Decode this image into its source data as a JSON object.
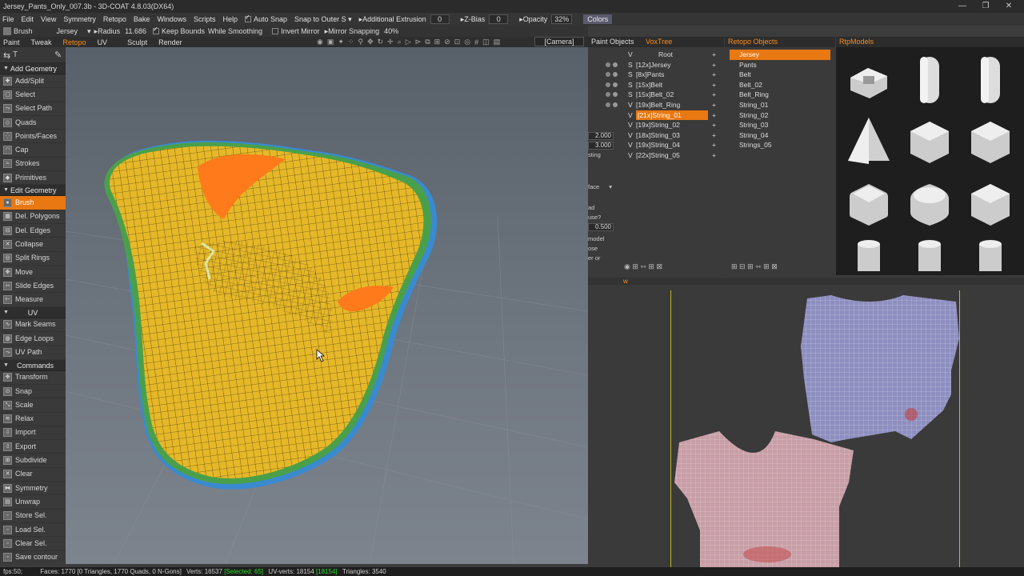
{
  "window": {
    "title": "Jersey_Pants_Only_007.3b - 3D-COAT 4.8.03(DX64)",
    "controls": [
      "—",
      "❐",
      "✕"
    ]
  },
  "menu": [
    "File",
    "Edit",
    "View",
    "Symmetry",
    "Retopo",
    "Bake",
    "Windows",
    "Scripts",
    "Help"
  ],
  "topopts": {
    "auto_snap": "Auto Snap",
    "snap_to_outer": "Snap to Outer S",
    "additional_extrusion": "Additional Extrusion",
    "extrusion_value": "0",
    "zbias_label": "Z-Bias",
    "zbias_value": "0",
    "opacity_label": "Opacity",
    "opacity_value": "32%",
    "colors": "Colors"
  },
  "toolopts": {
    "tool": "Brush",
    "object": "Jersey",
    "radius_label": "Radius",
    "radius_value": "11.686",
    "keep_bounds": "Keep Bounds",
    "while_smoothing": "While Smoothing",
    "invert_mirror": "Invert Mirror",
    "mirror_snapping": "Mirror Snapping",
    "mirror_snapping_value": "40%"
  },
  "rooms": [
    "Paint",
    "Tweak",
    "Retopo",
    "UV",
    "Sculpt",
    "Render"
  ],
  "camera": "[Camera]",
  "toolpanel": {
    "add_geometry": "Add Geometry",
    "add_tools": [
      "Add/Split",
      "Select",
      "Select Path",
      "Quads",
      "Points/Faces",
      "Cap",
      "Strokes",
      "Primitives"
    ],
    "edit_geometry": "Edit Geometry",
    "edit_tools": [
      "Brush",
      "Del. Polygons",
      "Del. Edges",
      "Collapse",
      "Split Rings",
      "Move",
      "Slide Edges",
      "Measure"
    ],
    "uv": "UV",
    "uv_tools": [
      "Mark Seams",
      "Edge Loops",
      "UV Path"
    ],
    "commands": "Commands",
    "command_tools": [
      "Transform",
      "Snap",
      "Scale",
      "Relax",
      "Import",
      "Export",
      "Subdivide",
      "Clear",
      "Symmetry",
      "Unwrap",
      "Store Sel.",
      "Load Sel.",
      "Clear Sel.",
      "Save contour"
    ]
  },
  "paint_objects": {
    "tab1": "Paint Objects",
    "tab2": "VoxTree",
    "items": [
      {
        "s": "",
        "v": "V",
        "name": "Root"
      },
      {
        "s": "S",
        "v": "",
        "name": "[12x]Jersey"
      },
      {
        "s": "S",
        "v": "",
        "name": "[8x]Pants"
      },
      {
        "s": "S",
        "v": "",
        "name": "[15x]Belt"
      },
      {
        "s": "S",
        "v": "",
        "name": "[15x]Belt_02"
      },
      {
        "s": "",
        "v": "V",
        "name": "[19x]Belt_Ring"
      },
      {
        "s": "",
        "v": "V",
        "name": "[21x]String_01"
      },
      {
        "s": "",
        "v": "V",
        "name": "[19x]String_02"
      },
      {
        "s": "",
        "v": "V",
        "name": "[18x]String_03"
      },
      {
        "s": "",
        "v": "V",
        "name": "[19x]String_04"
      },
      {
        "s": "",
        "v": "V",
        "name": "[22x]String_05"
      }
    ]
  },
  "props": {
    "val1": "2.000",
    "val2": "3.000",
    "t1": "sting",
    "dropdown": "face",
    "t2": "ad",
    "t3": "use?",
    "val3": "0.500",
    "t4": "model",
    "t5": "ose",
    "t6": "er or"
  },
  "retopo_objects": {
    "title": "Retopo Objects",
    "items": [
      "Jersey",
      "Pants",
      "Belt",
      "Belt_02",
      "Belt_Ring",
      "String_01",
      "String_02",
      "String_03",
      "String_04",
      "Strings_05"
    ]
  },
  "rtpmodels": {
    "title": "RtpModels"
  },
  "status": {
    "fps": "fps:50;",
    "faces": "Faces: 1770 [0 Triangles, 1770 Quads, 0 N-Gons]",
    "verts": "Verts: 16537",
    "selected": "[Selected: 65]",
    "uvverts": "UV-verts: 18154",
    "uvverts_hl": "[18154]",
    "triangles": "Triangles: 3540"
  }
}
